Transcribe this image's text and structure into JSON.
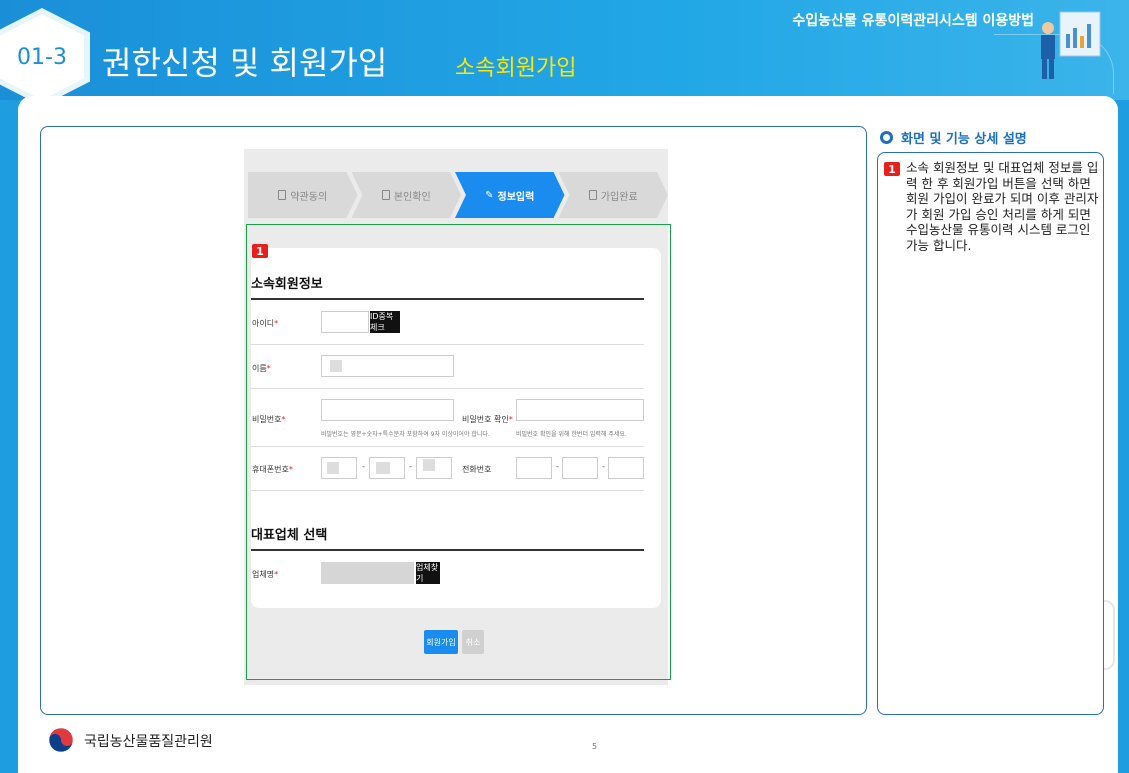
{
  "header": {
    "top_title": "수입농산물 유통이력관리시스템 이용방법",
    "section_no": "01-3",
    "main_title": "권한신청 및 회원가입",
    "sub_title": "소속회원가입"
  },
  "steps": [
    {
      "label": "약관동의",
      "active": false
    },
    {
      "label": "본인확인",
      "active": false
    },
    {
      "label": "정보입력",
      "active": true
    },
    {
      "label": "가입완료",
      "active": false
    }
  ],
  "form": {
    "marker": "1",
    "member_section_title": "소속회원정보",
    "id_label": "아이디",
    "id_check_button": "ID중복체크",
    "name_label": "이름",
    "password_label": "비밀번호",
    "password_help": "비밀번호는 영문+숫자+특수문자 포함하여 9자 이상이어야 합니다.",
    "password_confirm_label": "비밀번호 확인",
    "password_confirm_help": "비밀번호 확인을 위해 한번더 입력해 주세요.",
    "mobile_label": "휴대폰번호",
    "phone_label": "전화번호",
    "company_section_title": "대표업체 선택",
    "company_label": "업체명",
    "company_search_button": "업체찾기",
    "required_mark": "*",
    "dash": "-",
    "submit_button": "회원가입",
    "cancel_button": "취소"
  },
  "details": {
    "title": "화면 및 기능 상세 설명",
    "marker": "1",
    "text": "소속 회원정보 및 대표업체 정보를 입력 한 후 회원가입 버튼을 선택 하면 회원 가입이 완료가 되며 이후 관리자가 회원 가입 승인 처리를 하게 되면 수입농산물 유통이력 시스템 로그인 가능 합니다."
  },
  "footer": {
    "organization": "국립농산물품질관리원",
    "page_number": "5"
  },
  "colors": {
    "brand_blue": "#1a8fd8",
    "title_yellow": "#ffe600",
    "marker_red": "#e8201b",
    "step_active": "#1a8cf0",
    "highlight_green": "#1aa04a"
  }
}
